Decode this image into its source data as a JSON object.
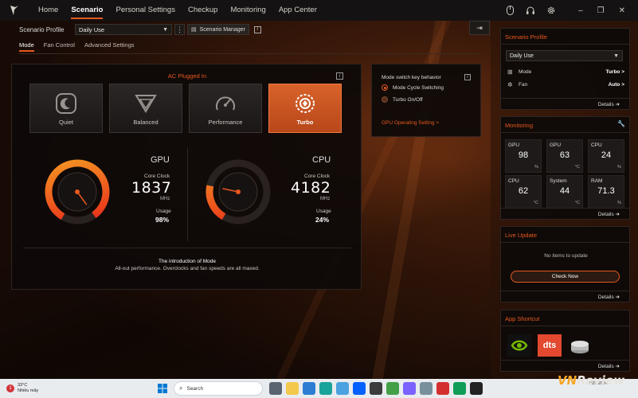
{
  "nav": {
    "items": [
      "Home",
      "Scenario",
      "Personal Settings",
      "Checkup",
      "Monitoring",
      "App Center"
    ],
    "active": "Scenario"
  },
  "top_icons": [
    "mouse-icon",
    "headset-icon",
    "settings-icon"
  ],
  "profile": {
    "label": "Scenario Profile",
    "value": "Daily Use",
    "manager_label": "Scenario Manager"
  },
  "subtabs": [
    "Mode",
    "Fan Control",
    "Advanced Settings"
  ],
  "mode_panel": {
    "ac_status": "AC Plugged In",
    "modes": [
      {
        "label": "Quiet",
        "icon": "quiet-icon"
      },
      {
        "label": "Balanced",
        "icon": "balanced-icon"
      },
      {
        "label": "Performance",
        "icon": "performance-icon"
      },
      {
        "label": "Turbo",
        "icon": "turbo-icon"
      }
    ],
    "active_mode": "Turbo",
    "gpu": {
      "title": "GPU",
      "clock_label": "Core Clock",
      "clock": "1837",
      "clock_unit": "MHz",
      "usage_label": "Usage",
      "usage": "98%",
      "usage_fraction": 0.98
    },
    "cpu": {
      "title": "CPU",
      "clock_label": "Core Clock",
      "clock": "4182",
      "clock_unit": "MHz",
      "usage_label": "Usage",
      "usage": "24%",
      "usage_fraction": 0.24
    },
    "intro_title": "The introduction of Mode",
    "intro_desc": "All-out performance. Overclocks and fan speeds are all maxed."
  },
  "switch_panel": {
    "title": "Mode switch key behavior",
    "options": [
      "Mode Cycle Switching",
      "Turbo On/Off"
    ],
    "selected": "Mode Cycle Switching",
    "link": "GPU Operating Setting >"
  },
  "sidebar": {
    "scenario_profile": {
      "title": "Scenario Profile",
      "value": "Daily Use",
      "rows": [
        {
          "label": "Mode",
          "value": "Turbo >",
          "icon": "mode-icon"
        },
        {
          "label": "Fan",
          "value": "Auto >",
          "icon": "fan-icon"
        }
      ],
      "details": "Details"
    },
    "monitoring": {
      "title": "Monitoring",
      "tiles": [
        {
          "label": "GPU",
          "value": "98",
          "unit": "%"
        },
        {
          "label": "GPU",
          "value": "63",
          "unit": "°C"
        },
        {
          "label": "CPU",
          "value": "24",
          "unit": "%"
        },
        {
          "label": "CPU",
          "value": "62",
          "unit": "°C"
        },
        {
          "label": "System",
          "value": "44",
          "unit": "°C"
        },
        {
          "label": "RAM",
          "value": "71.3",
          "unit": "%"
        }
      ],
      "details": "Details"
    },
    "live_update": {
      "title": "Live Update",
      "empty": "No items to update",
      "button": "Check Now",
      "details": "Details"
    },
    "app_shortcut": {
      "title": "App Shortcut",
      "apps": [
        "nvidia-app-icon",
        "dts-app-icon",
        "storage-app-icon"
      ],
      "dts_text": "dts",
      "details": "Details"
    }
  },
  "taskbar": {
    "weather_badge": "1",
    "temp": "33°C",
    "weather": "Nhiều mây",
    "search_placeholder": "Search",
    "date": "7/29/2024"
  },
  "watermark": {
    "brand": "VN",
    "text": "Review"
  },
  "colors": {
    "accent": "#e8581f",
    "panel": "#0e0a09"
  }
}
